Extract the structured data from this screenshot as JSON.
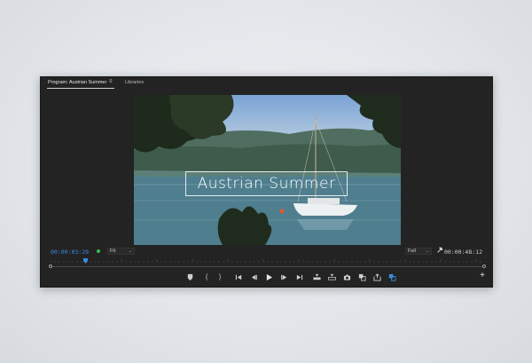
{
  "window": {
    "tabs": [
      {
        "label": "Program: Austrian Summer",
        "active": true
      },
      {
        "label": "Libraries",
        "active": false
      }
    ],
    "tab_menu_icon": "hamburger-icon"
  },
  "viewer": {
    "title_overlay": "Austrian Summer"
  },
  "status": {
    "current_timecode": "00:00:03:29",
    "duration_timecode": "00:00:48:12",
    "zoom_select": "Fit",
    "resolution_select": "Full",
    "playhead_position": 0.08
  },
  "transport": {
    "buttons": [
      "add-marker-icon",
      "mark-in-icon",
      "mark-out-icon",
      "go-to-in-icon",
      "step-back-icon",
      "play-icon",
      "step-forward-icon",
      "go-to-out-icon",
      "insert-icon",
      "overwrite-icon",
      "export-frame-icon",
      "comparison-view-icon",
      "export-icon",
      "vr-view-icon",
      "add-button-icon"
    ]
  },
  "colors": {
    "accent": "#3a8dde",
    "panel": "#232323",
    "indicator": "#31c24a"
  }
}
